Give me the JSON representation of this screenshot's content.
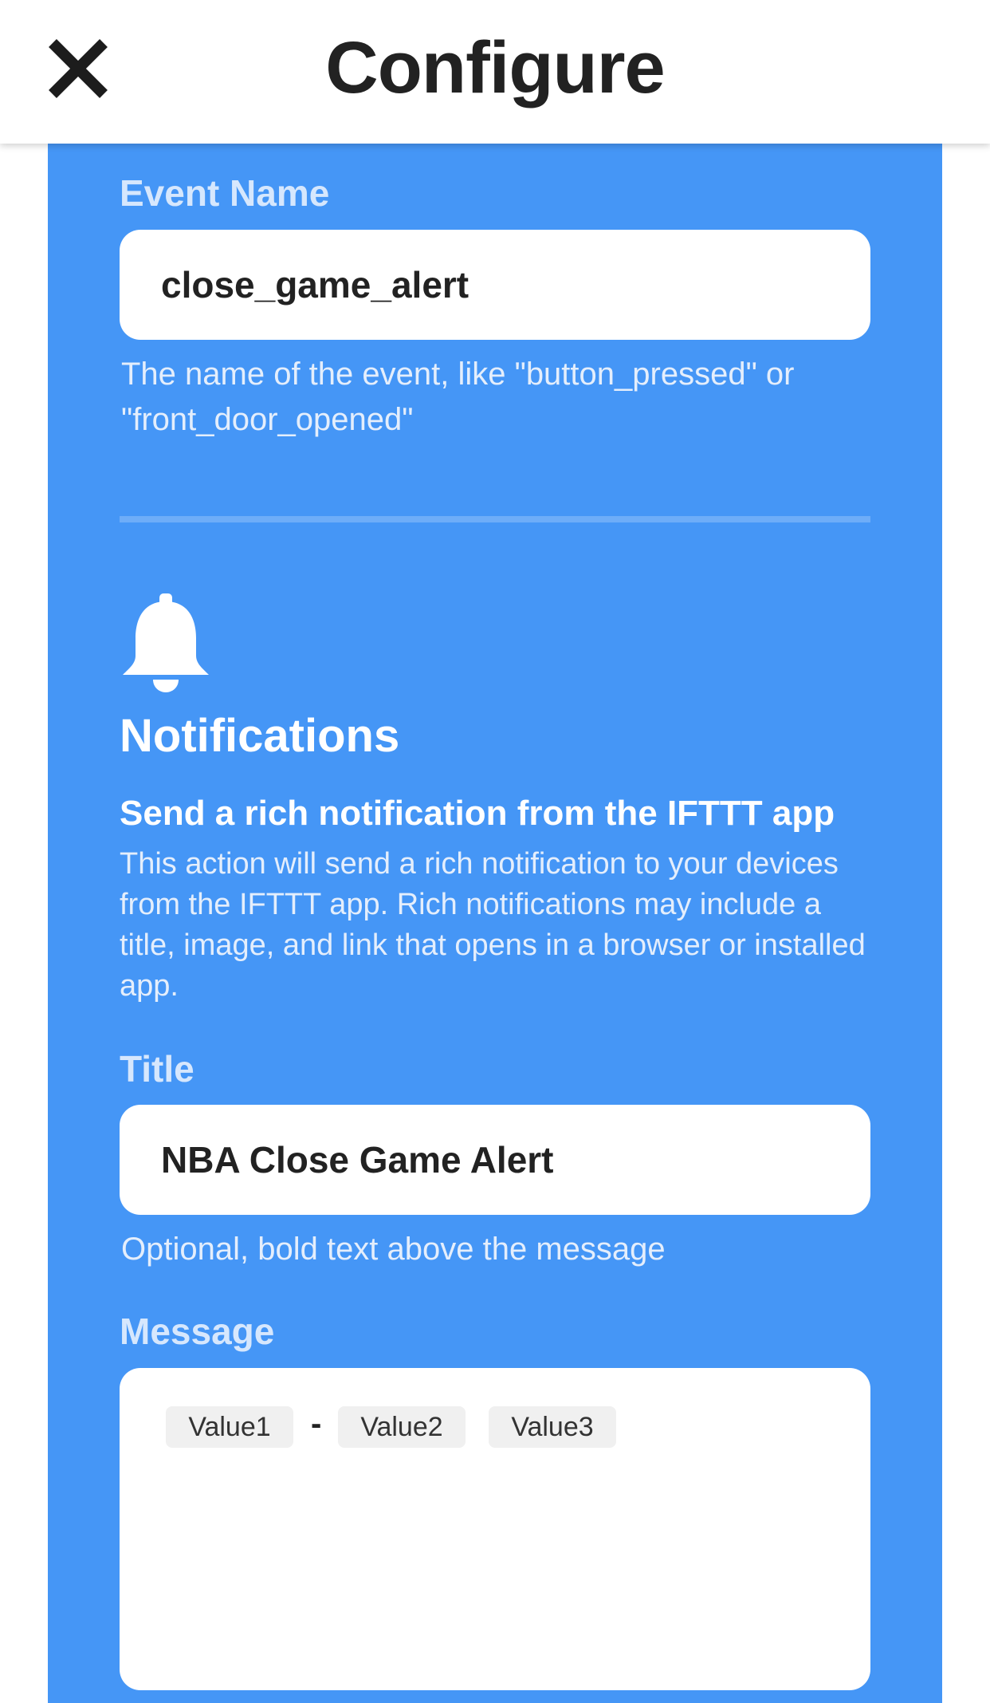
{
  "header": {
    "title": "Configure",
    "close_icon": "close-icon"
  },
  "colors": {
    "panel": "#4596f6",
    "label": "#d6e7fd",
    "divider": "#6eadf8"
  },
  "event": {
    "label": "Event Name",
    "value": "close_game_alert",
    "helper": "The name of the event, like \"button_pressed\" or \"front_door_opened\""
  },
  "service": {
    "icon": "bell-icon",
    "name": "Notifications",
    "action_title": "Send a rich notification from the IFTTT app",
    "action_description": "This action will send a rich notification to your devices from the IFTTT app. Rich notifications may include a title, image, and link that opens in a browser or installed app."
  },
  "title_field": {
    "label": "Title",
    "value": "NBA Close Game Alert",
    "helper": "Optional, bold text above the message"
  },
  "message_field": {
    "label": "Message",
    "tokens": [
      "Value1",
      "Value2",
      "Value3"
    ],
    "separator": "-"
  }
}
